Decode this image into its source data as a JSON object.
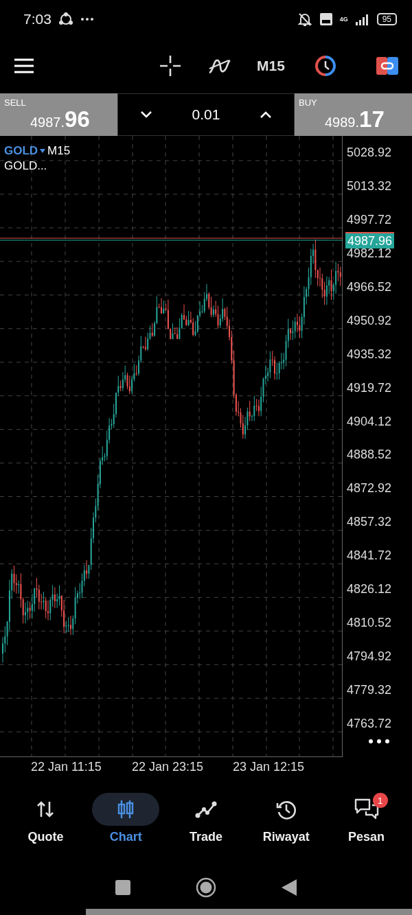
{
  "status_bar": {
    "time": "7:03",
    "network": "4G",
    "battery": "95"
  },
  "toolbar": {
    "timeframe": "M15"
  },
  "trade_panel": {
    "sell": {
      "label": "SELL",
      "price_small": "4987.",
      "price_big": "96"
    },
    "volume": "0.01",
    "buy": {
      "label": "BUY",
      "price_small": "4989.",
      "price_big": "17"
    }
  },
  "chart": {
    "symbol": "GOLD",
    "timeframe": "M15",
    "description": "GOLD...",
    "current_price": "4987.96",
    "price_labels": [
      "5028.92",
      "5013.32",
      "4997.72",
      "4982.12",
      "4966.52",
      "4950.92",
      "4935.32",
      "4919.72",
      "4904.12",
      "4888.52",
      "4872.92",
      "4857.32",
      "4841.72",
      "4826.12",
      "4810.52",
      "4794.92",
      "4779.32",
      "4763.72"
    ],
    "time_labels": [
      "22 Jan 11:15",
      "22 Jan 23:15",
      "23 Jan 12:15"
    ]
  },
  "nav": [
    {
      "label": "Quote",
      "selected": false
    },
    {
      "label": "Chart",
      "selected": true
    },
    {
      "label": "Trade",
      "selected": false
    },
    {
      "label": "Riwayat",
      "selected": false
    },
    {
      "label": "Pesan",
      "selected": false,
      "badge": "1"
    }
  ]
}
